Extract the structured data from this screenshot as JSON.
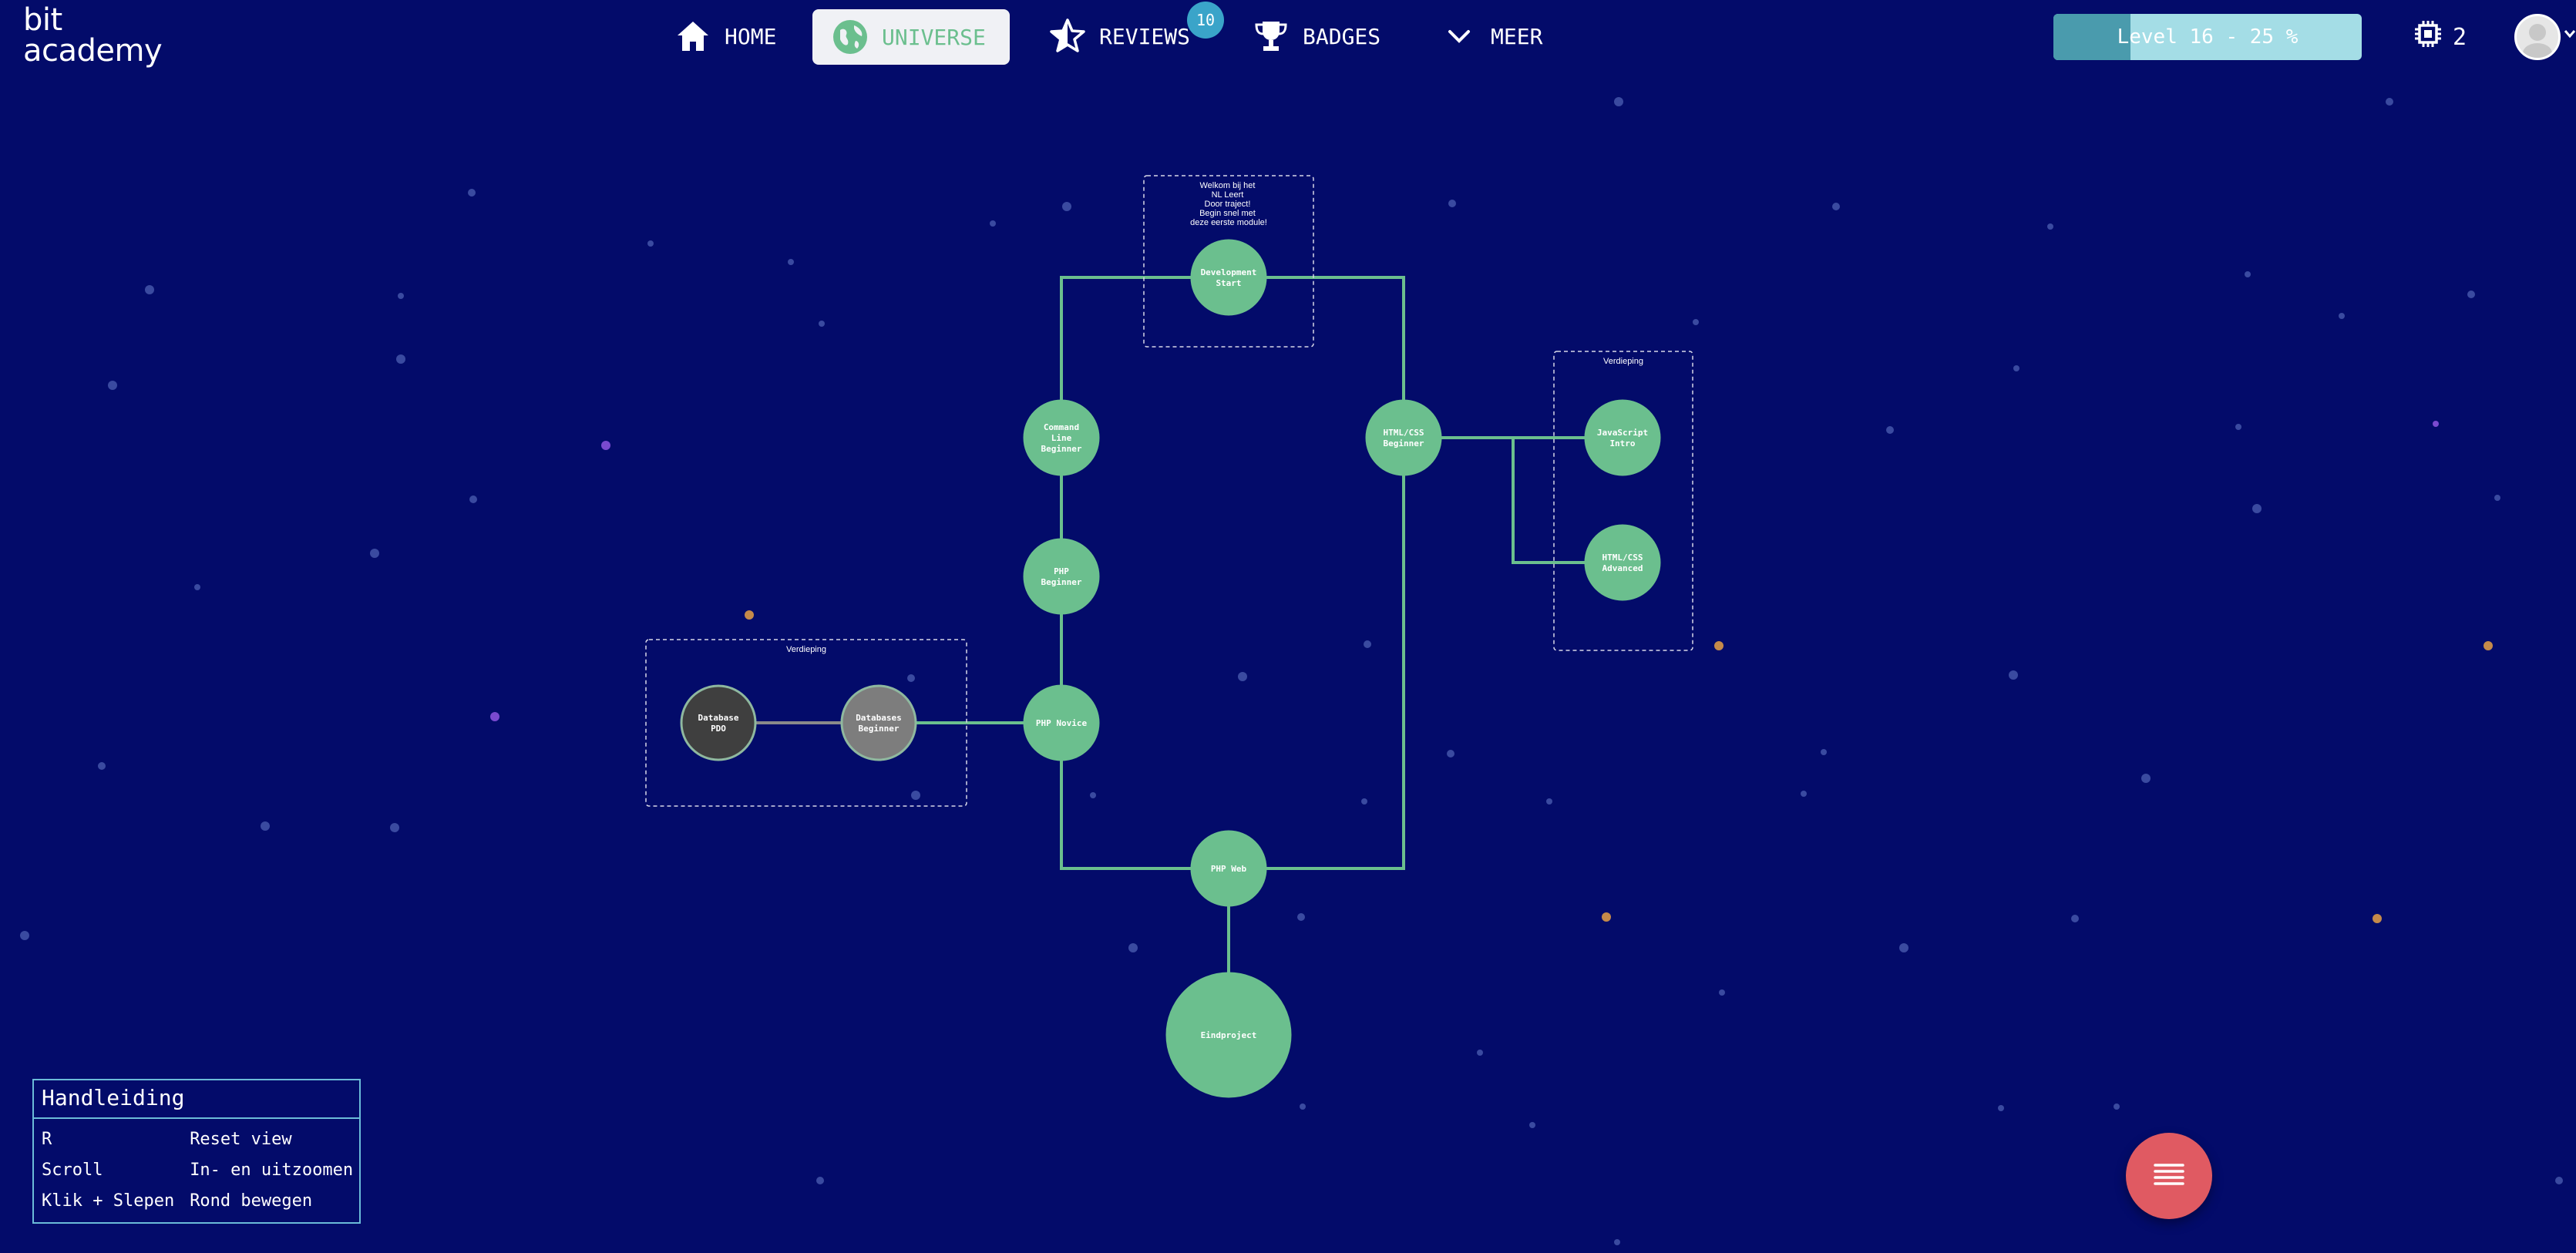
{
  "brand": {
    "line1": "bit",
    "line2": "academy"
  },
  "nav": {
    "items": [
      {
        "label": "HOME",
        "icon": "home-icon"
      },
      {
        "label": "UNIVERSE",
        "icon": "globe-icon",
        "active": true
      },
      {
        "label": "REVIEWS",
        "icon": "star-icon",
        "count": "10"
      },
      {
        "label": "BADGES",
        "icon": "trophy-icon"
      },
      {
        "label": "MEER",
        "icon": "chevron-down-icon"
      }
    ]
  },
  "level": {
    "label": "Level 16 - 25 %",
    "progress": 0.25
  },
  "credits": {
    "value": "2",
    "icon": "chip-icon"
  },
  "user": {
    "icon": "avatar-icon"
  },
  "colors": {
    "background": "#030b6a",
    "node_done": "#6bbf8e",
    "node_locked_dark": "#3f3f3f",
    "node_locked_gray": "#7d7d7d",
    "fab": "#e05a62",
    "link": "#6bbf8e"
  },
  "map": {
    "boxes": {
      "welcome": "Welkom bij het NL Leert Door traject! Begin snel met deze eerste module!",
      "verdieping_left": "Verdieping",
      "verdieping_right": "Verdieping"
    },
    "nodes": {
      "dev_start": [
        "Development",
        "Start"
      ],
      "command_line": [
        "Command",
        "Line",
        "Beginner"
      ],
      "php_beginner": [
        "PHP",
        "Beginner"
      ],
      "php_novice": [
        "PHP Novice"
      ],
      "database_pdo": [
        "Database",
        "PDO"
      ],
      "databases_beginner": [
        "Databases",
        "Beginner"
      ],
      "php_web": [
        "PHP Web"
      ],
      "eindproject": [
        "Eindproject"
      ],
      "htmlcss_beginner": [
        "HTML/CSS",
        "Beginner"
      ],
      "javascript_intro": [
        "JavaScript",
        "Intro"
      ],
      "htmlcss_advanced": [
        "HTML/CSS",
        "Advanced"
      ]
    }
  },
  "manual": {
    "title": "Handleiding",
    "rows": [
      {
        "key": "R",
        "value": "Reset view"
      },
      {
        "key": "Scroll",
        "value": "In- en uitzoomen"
      },
      {
        "key": "Klik + Slepen",
        "value": "Rond bewegen"
      }
    ]
  },
  "fab": {
    "icon": "menu-icon"
  }
}
